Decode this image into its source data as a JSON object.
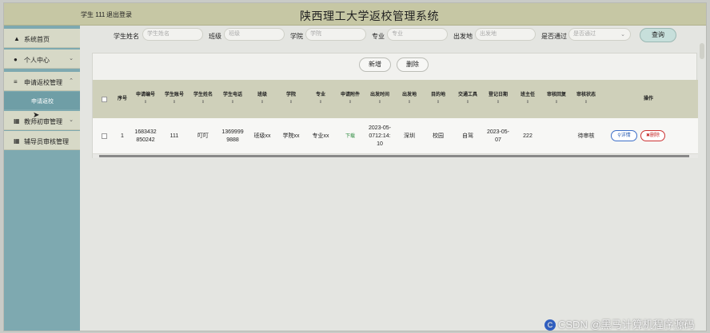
{
  "app": {
    "title": "陕西理工大学返校管理系统",
    "user_label": "学生 111",
    "logout_label": "退出登录"
  },
  "sidebar": {
    "items": [
      {
        "label": "系统首页",
        "icon": "home-icon"
      },
      {
        "label": "个人中心",
        "icon": "user-icon",
        "chevron": "⌄"
      },
      {
        "label": "申请返校管理",
        "icon": "list-icon",
        "chevron": "⌃"
      },
      {
        "label": "申请返校",
        "sub": true
      },
      {
        "label": "教师初审管理",
        "icon": "grid-icon",
        "chevron": "⌄"
      },
      {
        "label": "辅导员审核管理",
        "icon": "grid-icon"
      }
    ]
  },
  "filters": [
    {
      "label": "学生姓名",
      "placeholder": "学生姓名"
    },
    {
      "label": "班级",
      "placeholder": "班级"
    },
    {
      "label": "学院",
      "placeholder": "学院"
    },
    {
      "label": "专业",
      "placeholder": "专业"
    },
    {
      "label": "出发地",
      "placeholder": "出发地"
    },
    {
      "label": "是否通过",
      "placeholder": "是否通过",
      "select": true
    }
  ],
  "query_label": "查询",
  "actions": {
    "add": "新增",
    "delete": "删除"
  },
  "table": {
    "columns": [
      {
        "label": "",
        "sort": false
      },
      {
        "label": "序号",
        "sort": false
      },
      {
        "label": "申请编号",
        "sort": true
      },
      {
        "label": "学生账号",
        "sort": true
      },
      {
        "label": "学生姓名",
        "sort": true
      },
      {
        "label": "学生电话",
        "sort": true
      },
      {
        "label": "班级",
        "sort": true
      },
      {
        "label": "学院",
        "sort": true
      },
      {
        "label": "专业",
        "sort": true
      },
      {
        "label": "申请附件",
        "sort": true
      },
      {
        "label": "出发时间",
        "sort": true
      },
      {
        "label": "出发地",
        "sort": true
      },
      {
        "label": "目的地",
        "sort": true
      },
      {
        "label": "交通工具",
        "sort": true
      },
      {
        "label": "登记日期",
        "sort": true
      },
      {
        "label": "班主任",
        "sort": true
      },
      {
        "label": "审核回复",
        "sort": true
      },
      {
        "label": "审核状态",
        "sort": true
      },
      {
        "label": "操作",
        "sort": false
      }
    ],
    "rows": [
      {
        "index": "1",
        "apply_no": "1683432850242",
        "student_account": "111",
        "student_name": "叮叮",
        "phone": "13699999888",
        "class": "班级xx",
        "college": "学院xx",
        "major": "专业xx",
        "attachment": "下载",
        "depart_time": "2023-05-0712:14:10",
        "from": "深圳",
        "to": "校园",
        "transport": "自驾",
        "reg_date": "2023-05-07",
        "head_teacher": "222",
        "reply": "",
        "status": "待审核",
        "detail_label": "详情",
        "delete_label": "删除"
      }
    ]
  },
  "watermark": "CSDN @黑马计算机程序源码",
  "colors": {
    "topbar": "#c6c7a4",
    "sidebar": "#7ea9b0",
    "table_header": "#cfd0ba",
    "accent_blue": "#2d5fb5",
    "accent_red": "#c62828"
  }
}
